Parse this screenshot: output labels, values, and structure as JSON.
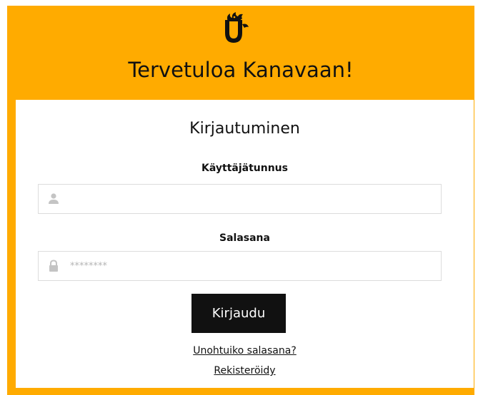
{
  "header": {
    "logo_icon": "rooster-u-logo",
    "welcome_text": "Tervetuloa Kanavaan!",
    "accent_color": "#ffab00"
  },
  "login": {
    "title": "Kirjautuminen",
    "username": {
      "label": "Käyttäjätunnus",
      "value": "",
      "placeholder": "",
      "icon": "user-icon"
    },
    "password": {
      "label": "Salasana",
      "value": "",
      "placeholder": "********",
      "icon": "lock-icon"
    },
    "submit_label": "Kirjaudu",
    "forgot_password_link": "Unohtuiko salasana?",
    "register_link": "Rekisteröidy"
  }
}
